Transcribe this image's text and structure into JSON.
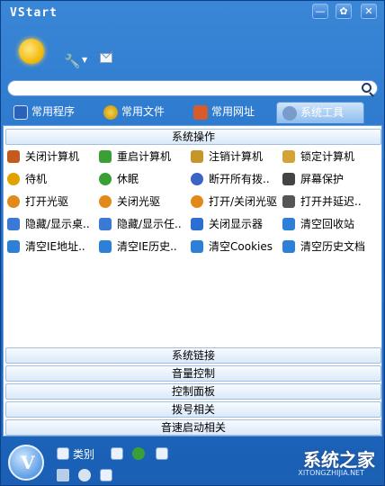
{
  "window": {
    "title": "VStart"
  },
  "title_buttons": {
    "minimize": "—",
    "skin": "✿",
    "close": "✕"
  },
  "search": {
    "value": "",
    "placeholder": ""
  },
  "tabs": [
    {
      "label": "常用程序",
      "icon": "monitor-icon"
    },
    {
      "label": "常用文件",
      "icon": "folder-icon"
    },
    {
      "label": "常用网址",
      "icon": "home-icon"
    },
    {
      "label": "系统工具",
      "icon": "tools-icon"
    }
  ],
  "sections_top": {
    "title": "系统操作"
  },
  "items": [
    {
      "label": "关闭计算机",
      "color": "#c45a1d"
    },
    {
      "label": "重启计算机",
      "color": "#3aa035"
    },
    {
      "label": "注销计算机",
      "color": "#c7962a"
    },
    {
      "label": "锁定计算机",
      "color": "#d5a23a"
    },
    {
      "label": "待机",
      "color": "#e0a200"
    },
    {
      "label": "休眠",
      "color": "#3aa035"
    },
    {
      "label": "断开所有拨..",
      "color": "#3a64c5"
    },
    {
      "label": "屏幕保护",
      "color": "#444444"
    },
    {
      "label": "打开光驱",
      "color": "#e08a1a"
    },
    {
      "label": "关闭光驱",
      "color": "#e08a1a"
    },
    {
      "label": "打开/关闭光驱",
      "color": "#e08a1a"
    },
    {
      "label": "打开并延迟..",
      "color": "#555555"
    },
    {
      "label": "隐藏/显示桌..",
      "color": "#3a7ad5"
    },
    {
      "label": "隐藏/显示任..",
      "color": "#3a7ad5"
    },
    {
      "label": "关闭显示器",
      "color": "#2d6fd0"
    },
    {
      "label": "清空回收站",
      "color": "#2e7fd6"
    },
    {
      "label": "清空IE地址..",
      "color": "#2e7fd6"
    },
    {
      "label": "清空IE历史..",
      "color": "#2e7fd6"
    },
    {
      "label": "清空Cookies",
      "color": "#2e7fd6"
    },
    {
      "label": "清空历史文档",
      "color": "#2e7fd6"
    }
  ],
  "sections_bottom": [
    "系统链接",
    "音量控制",
    "控制面板",
    "拨号相关",
    "音速启动相关"
  ],
  "footer": {
    "logo": "V",
    "category_label": "类别",
    "watermark": "系统之家",
    "watermark_sub": "XITONGZHIJIA.NET"
  }
}
